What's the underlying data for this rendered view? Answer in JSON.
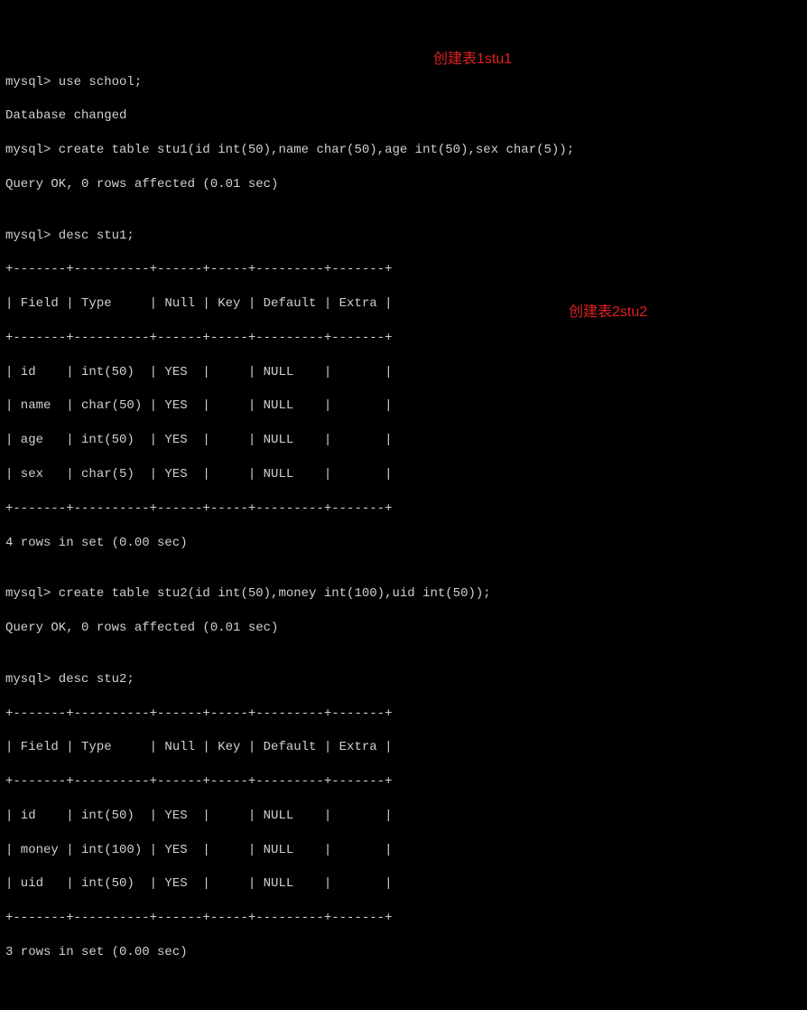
{
  "lines": {
    "l1": "mysql> use school;",
    "l2": "Database changed",
    "l3": "mysql> create table stu1(id int(50),name char(50),age int(50),sex char(5));",
    "l4": "Query OK, 0 rows affected (0.01 sec)",
    "l5": "",
    "l6": "mysql> desc stu1;",
    "l7": "+-------+----------+------+-----+---------+-------+",
    "l8": "| Field | Type     | Null | Key | Default | Extra |",
    "l9": "+-------+----------+------+-----+---------+-------+",
    "l10": "| id    | int(50)  | YES  |     | NULL    |       |",
    "l11": "| name  | char(50) | YES  |     | NULL    |       |",
    "l12": "| age   | int(50)  | YES  |     | NULL    |       |",
    "l13": "| sex   | char(5)  | YES  |     | NULL    |       |",
    "l14": "+-------+----------+------+-----+---------+-------+",
    "l15": "4 rows in set (0.00 sec)",
    "l16": "",
    "l17": "mysql> create table stu2(id int(50),money int(100),uid int(50));",
    "l18": "Query OK, 0 rows affected (0.01 sec)",
    "l19": "",
    "l20": "mysql> desc stu2;",
    "l21": "+-------+----------+------+-----+---------+-------+",
    "l22": "| Field | Type     | Null | Key | Default | Extra |",
    "l23": "+-------+----------+------+-----+---------+-------+",
    "l24": "| id    | int(50)  | YES  |     | NULL    |       |",
    "l25": "| money | int(100) | YES  |     | NULL    |       |",
    "l26": "| uid   | int(50)  | YES  |     | NULL    |       |",
    "l27": "+-------+----------+------+-----+---------+-------+",
    "l28": "3 rows in set (0.00 sec)"
  },
  "annotations": {
    "a1": "创建表1stu1",
    "a2": "创建表2stu2"
  }
}
